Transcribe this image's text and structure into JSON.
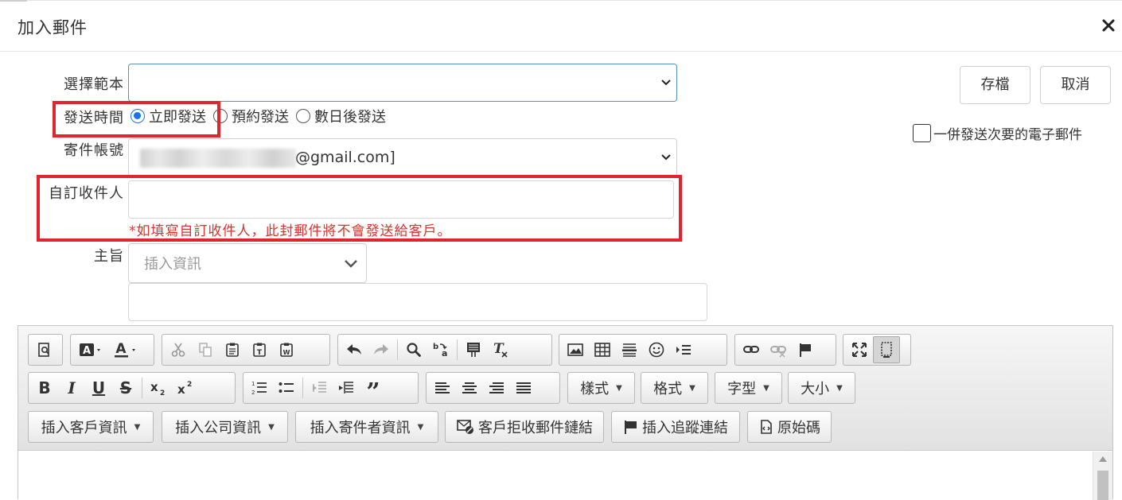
{
  "dialog": {
    "title": "加入郵件",
    "close_icon": "close-icon"
  },
  "form": {
    "template": {
      "label": "選擇範本",
      "value": ""
    },
    "send_time": {
      "label": "發送時間",
      "options": [
        "立即發送",
        "預約發送",
        "數日後發送"
      ],
      "selected": "立即發送"
    },
    "sender": {
      "label": "寄件帳號",
      "value": "@gmail.com]"
    },
    "custom_recipient": {
      "label": "自訂收件人",
      "value": "",
      "warning": "*如填寫自訂收件人，此封郵件將不會發送給客戶。"
    },
    "subject": {
      "label": "主旨",
      "insert_placeholder": "插入資訊",
      "value": ""
    }
  },
  "actions": {
    "save": "存檔",
    "cancel": "取消"
  },
  "secondary_email": {
    "label": "一併發送次要的電子郵件",
    "checked": false
  },
  "editor": {
    "toolbar_row2_combos": [
      "樣式",
      "格式",
      "字型",
      "大小"
    ],
    "toolbar_row3": {
      "insert_customer": "插入客戶資訊",
      "insert_company": "插入公司資訊",
      "insert_sender": "插入寄件者資訊",
      "unsubscribe_link": "客戶拒收郵件鏈結",
      "tracking_link": "插入追蹤連結",
      "source": "原始碼"
    },
    "content": ""
  },
  "colors": {
    "highlight_red": "#e0262b",
    "warning_red": "#d9332e",
    "radio_blue": "#1a73e8",
    "focus_border": "#5b8fc7"
  }
}
